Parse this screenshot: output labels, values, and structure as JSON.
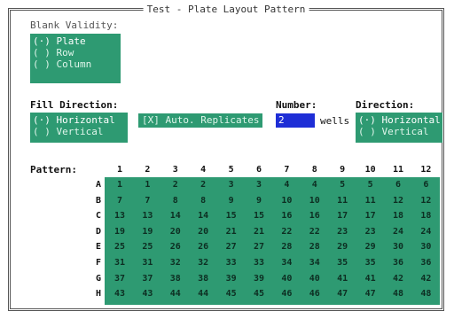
{
  "window": {
    "title": "Test - Plate Layout Pattern"
  },
  "blank_validity": {
    "label": "Blank Validity:",
    "options": [
      "(·) Plate",
      "( ) Row",
      "( ) Column"
    ],
    "selected": 0
  },
  "fill_direction": {
    "label": "Fill Direction:",
    "options": [
      "(·) Horizontal",
      "( ) Vertical"
    ],
    "selected": 0
  },
  "auto_replicates": {
    "label": "[X] Auto. Replicates"
  },
  "number": {
    "label": "Number:",
    "value": "2",
    "suffix": "wells"
  },
  "direction": {
    "label": "Direction:",
    "options": [
      "(·) Horizontal",
      "( ) Vertical"
    ],
    "selected": 0
  },
  "pattern": {
    "label": "Pattern:",
    "columns": [
      "1",
      "2",
      "3",
      "4",
      "5",
      "6",
      "7",
      "8",
      "9",
      "10",
      "11",
      "12"
    ],
    "rows": [
      {
        "label": "A",
        "cells": [
          "1",
          "1",
          "2",
          "2",
          "3",
          "3",
          "4",
          "4",
          "5",
          "5",
          "6",
          "6"
        ]
      },
      {
        "label": "B",
        "cells": [
          "7",
          "7",
          "8",
          "8",
          "9",
          "9",
          "10",
          "10",
          "11",
          "11",
          "12",
          "12"
        ]
      },
      {
        "label": "C",
        "cells": [
          "13",
          "13",
          "14",
          "14",
          "15",
          "15",
          "16",
          "16",
          "17",
          "17",
          "18",
          "18"
        ]
      },
      {
        "label": "D",
        "cells": [
          "19",
          "19",
          "20",
          "20",
          "21",
          "21",
          "22",
          "22",
          "23",
          "23",
          "24",
          "24"
        ]
      },
      {
        "label": "E",
        "cells": [
          "25",
          "25",
          "26",
          "26",
          "27",
          "27",
          "28",
          "28",
          "29",
          "29",
          "30",
          "30"
        ]
      },
      {
        "label": "F",
        "cells": [
          "31",
          "31",
          "32",
          "32",
          "33",
          "33",
          "34",
          "34",
          "35",
          "35",
          "36",
          "36"
        ]
      },
      {
        "label": "G",
        "cells": [
          "37",
          "37",
          "38",
          "38",
          "39",
          "39",
          "40",
          "40",
          "41",
          "41",
          "42",
          "42"
        ]
      },
      {
        "label": "H",
        "cells": [
          "43",
          "43",
          "44",
          "44",
          "45",
          "45",
          "46",
          "46",
          "47",
          "47",
          "48",
          "48"
        ]
      }
    ]
  },
  "colors": {
    "accent_green": "#2e9a72",
    "input_blue": "#1e2ed6"
  }
}
